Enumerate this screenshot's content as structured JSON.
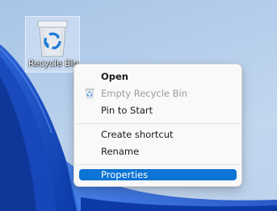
{
  "desktop": {
    "recycle_bin_label": "Recycle Bin"
  },
  "context_menu": {
    "items": [
      {
        "label": "Open",
        "bold": true
      },
      {
        "label": "Empty Recycle Bin",
        "disabled": true,
        "icon": "recycle-bin-icon"
      },
      {
        "label": "Pin to Start"
      },
      {
        "label": "Create shortcut"
      },
      {
        "label": "Rename"
      },
      {
        "label": "Properties",
        "selected": true
      }
    ]
  },
  "colors": {
    "selection": "#0c74d4",
    "wallpaper_bloom": "#1d55c9",
    "menu_background": "#f9f9f9"
  }
}
